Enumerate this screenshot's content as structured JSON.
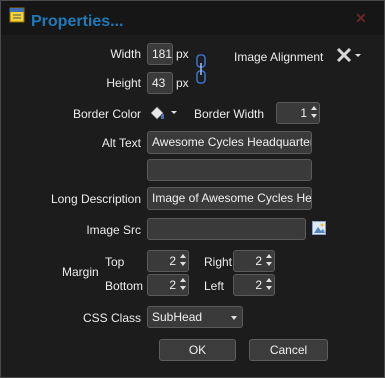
{
  "dialog": {
    "title": "Properties...",
    "icon": "properties-icon",
    "close_icon": "close-icon"
  },
  "size": {
    "width_label": "Width",
    "width_value": "181",
    "width_unit": "px",
    "height_label": "Height",
    "height_value": "43",
    "height_unit": "px",
    "lock_icon": "chain-link-icon"
  },
  "alignment": {
    "label": "Image Alignment",
    "icon": "alignment-none-icon"
  },
  "border": {
    "color_label": "Border Color",
    "color_icon": "paint-bucket-icon",
    "width_label": "Border Width",
    "width_value": "1"
  },
  "alt_text": {
    "label": "Alt Text",
    "value": "Awesome Cycles Headquarters",
    "second_value": ""
  },
  "long_description": {
    "label": "Long Description",
    "value": "Image of Awesome Cycles Headquarters"
  },
  "image_src": {
    "label": "Image Src",
    "value": "",
    "browse_icon": "image-browse-icon"
  },
  "margin": {
    "label": "Margin",
    "top_label": "Top",
    "top_value": "2",
    "right_label": "Right",
    "right_value": "2",
    "bottom_label": "Bottom",
    "bottom_value": "2",
    "left_label": "Left",
    "left_value": "2"
  },
  "css_class": {
    "label": "CSS Class",
    "value": "SubHead"
  },
  "buttons": {
    "ok": "OK",
    "cancel": "Cancel"
  }
}
